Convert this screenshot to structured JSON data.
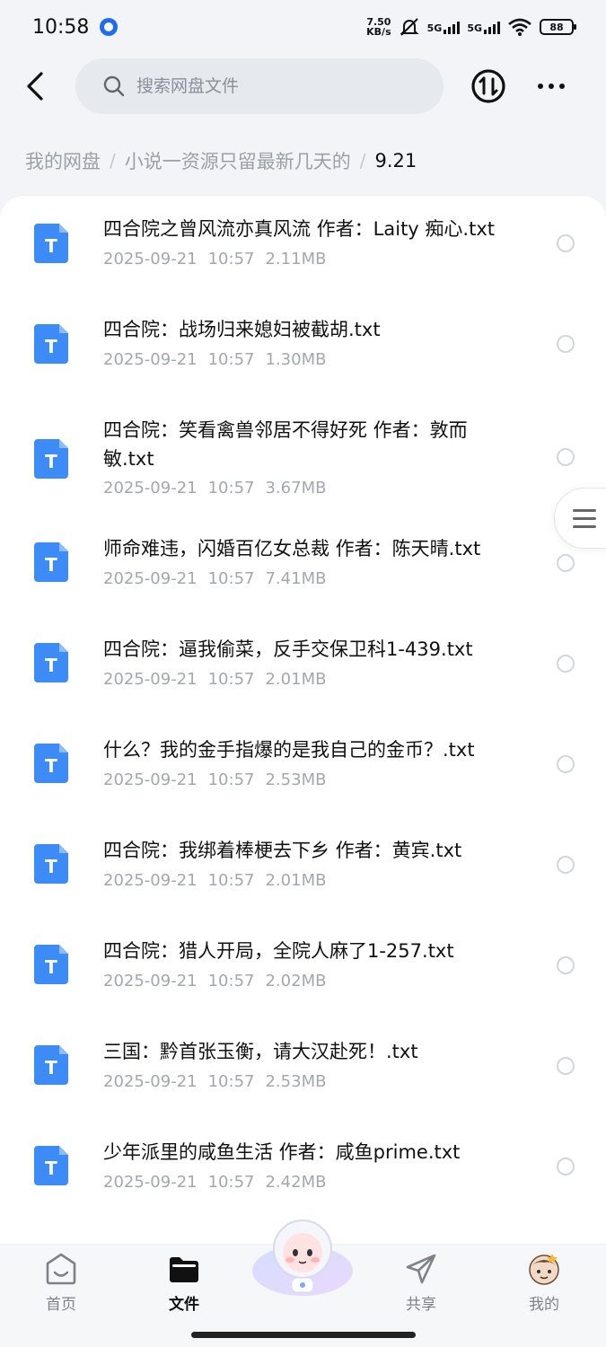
{
  "status_bar": {
    "time": "10:58",
    "net_speed_value": "7.50",
    "net_speed_unit": "KB/s",
    "signal_1": "5G",
    "signal_2": "5G",
    "battery": "88"
  },
  "search": {
    "placeholder": "搜索网盘文件"
  },
  "breadcrumb": [
    {
      "label": "我的网盘"
    },
    {
      "label": "小说一资源只留最新几天的"
    },
    {
      "label": "9.21"
    }
  ],
  "files": [
    {
      "name": "四合院之曾风流亦真风流 作者：Laity 痴心.txt",
      "date": "2025-09-21",
      "time": "10:57",
      "size": "2.11MB"
    },
    {
      "name": "四合院：战场归来媳妇被截胡.txt",
      "date": "2025-09-21",
      "time": "10:57",
      "size": "1.30MB"
    },
    {
      "name": "四合院：笑看禽兽邻居不得好死 作者：敦而敏.txt",
      "date": "2025-09-21",
      "time": "10:57",
      "size": "3.67MB"
    },
    {
      "name": "师命难违，闪婚百亿女总裁 作者：陈天晴.txt",
      "date": "2025-09-21",
      "time": "10:57",
      "size": "7.41MB"
    },
    {
      "name": "四合院：逼我偷菜，反手交保卫科1-439.txt",
      "date": "2025-09-21",
      "time": "10:57",
      "size": "2.01MB"
    },
    {
      "name": "什么？我的金手指爆的是我自己的金币？.txt",
      "date": "2025-09-21",
      "time": "10:57",
      "size": "2.53MB"
    },
    {
      "name": "四合院：我绑着棒梗去下乡 作者：黄宾.txt",
      "date": "2025-09-21",
      "time": "10:57",
      "size": "2.01MB"
    },
    {
      "name": "四合院：猎人开局，全院人麻了1-257.txt",
      "date": "2025-09-21",
      "time": "10:57",
      "size": "2.02MB"
    },
    {
      "name": "三国：黔首张玉衡，请大汉赴死！.txt",
      "date": "2025-09-21",
      "time": "10:57",
      "size": "2.53MB"
    },
    {
      "name": "少年派里的咸鱼生活 作者：咸鱼prime.txt",
      "date": "2025-09-21",
      "time": "10:57",
      "size": "2.42MB"
    }
  ],
  "file_icon_letter": "T",
  "bottom_nav": [
    {
      "label": "首页",
      "icon": "home-smile-icon",
      "active": false
    },
    {
      "label": "文件",
      "icon": "folder-icon",
      "active": true
    },
    {
      "label": "共享",
      "icon": "share-send-icon",
      "active": false
    },
    {
      "label": "我的",
      "icon": "avatar-icon",
      "active": false
    }
  ],
  "colors": {
    "file_icon_blue": "#3d8bf6",
    "background": "#f2f4f8",
    "muted_text": "#a3a7ae"
  }
}
